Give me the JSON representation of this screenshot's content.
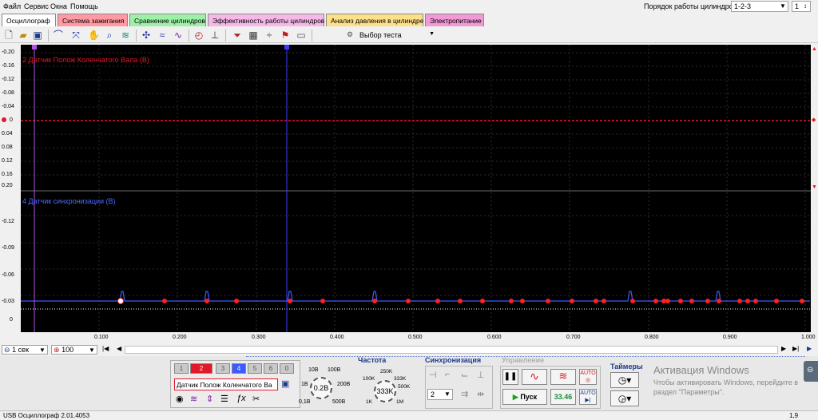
{
  "menu": [
    "Файл",
    "Сервис",
    "Окна",
    "Помощь"
  ],
  "cylinder_order": {
    "label": "Порядок работы цилиндров",
    "value": "1-2-3",
    "count": "1"
  },
  "tabs": [
    {
      "label": "Осциллограф",
      "color": "#ffffff"
    },
    {
      "label": "Система зажигания",
      "color": "#ff9aa2"
    },
    {
      "label": "Сравнение цилиндров",
      "color": "#9ef0a8"
    },
    {
      "label": "Эффективность работы цилиндров",
      "color": "#f5b8e8"
    },
    {
      "label": "Анализ давления в цилиндре",
      "color": "#fde08a"
    },
    {
      "label": "Электропитание",
      "color": "#f19ad6"
    }
  ],
  "toolbar": {
    "test_select": "Выбор теста"
  },
  "channel1": {
    "label": "2 Датчик Полож Коленчатого Вала (В)",
    "color": "#e0182a",
    "ticks": [
      "-0.20",
      "-0.16",
      "-0.12",
      "-0.08",
      "-0.04",
      "0",
      "0.04",
      "0.08",
      "0.12",
      "0.16",
      "0.20"
    ]
  },
  "channel2": {
    "label": "4 Датчик синхронизации (В)",
    "color": "#4a6bff",
    "ticks": [
      "-0.12",
      "-0.09",
      "-0.06",
      "-0.03",
      "0"
    ]
  },
  "xaxis": {
    "ticks": [
      "0.100",
      "0.200",
      "0.300",
      "0.400",
      "0.500",
      "0.600",
      "0.700",
      "0.800",
      "0.900",
      "1.000"
    ]
  },
  "cursors": {
    "c1": "1",
    "c2": "2"
  },
  "scroll": {
    "time": "1 сек",
    "zoom": "100"
  },
  "bottom": {
    "channels": [
      "1",
      "2",
      "3",
      "4",
      "5",
      "6",
      "0"
    ],
    "sensor_field": "Датчик Полож Коленчатого Ва",
    "volt_dial": {
      "value": "0.2В",
      "labels": [
        "10В",
        "100В",
        "1В",
        "200В",
        "0,1В",
        "500В"
      ]
    },
    "freq": {
      "title": "Частота",
      "value": "333K",
      "labels": [
        "250K",
        "100K",
        "333K",
        "500K",
        "1K",
        "1M"
      ]
    },
    "sync": {
      "title": "Синхронизация",
      "value": "2"
    },
    "control": {
      "title": "Управление",
      "start": "Пуск",
      "fps": "33.46",
      "auto1": "AUTO",
      "auto2": "AUTO"
    },
    "timers": {
      "title": "Таймеры"
    },
    "watermark": [
      "Активация Windows",
      "Чтобы активировать Windows, перейдите в",
      "раздел \"Параметры\"."
    ]
  },
  "status": {
    "left": "USB Осциллограф   2.01.4053",
    "right": "1,9"
  }
}
